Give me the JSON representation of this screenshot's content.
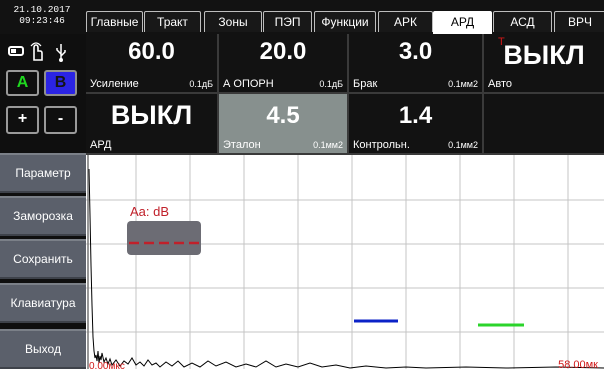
{
  "datetime": {
    "date": "21.10.2017",
    "time": "09:23:46"
  },
  "tabs": [
    "Главные",
    "Тракт",
    "Зоны",
    "ПЭП",
    "Функции",
    "АРК",
    "АРД",
    "АСД",
    "ВРЧ"
  ],
  "active_tab": "АРД",
  "left_buttons": {
    "a": "A",
    "b": "B",
    "plus": "+",
    "minus": "-"
  },
  "side_menu": [
    "Параметр",
    "Заморозка",
    "Сохранить",
    "Клавиатура",
    "Выход"
  ],
  "params": {
    "gain": {
      "value": "60.0",
      "label": "Усиление",
      "unit": "0.1дБ"
    },
    "ref": {
      "value": "20.0",
      "label": "А ОПОРН",
      "unit": "0.1дБ"
    },
    "reject": {
      "value": "3.0",
      "label": "Брак",
      "unit": "0.1мм2"
    },
    "auto": {
      "value": "ВЫКЛ",
      "label": "Авто",
      "overlay": "T"
    },
    "ard": {
      "value": "ВЫКЛ",
      "label": "АРД"
    },
    "etalon": {
      "value": "4.5",
      "label": "Эталон",
      "unit": "0.1мм2"
    },
    "control": {
      "value": "1.4",
      "label": "Контрольн.",
      "unit": "0.1мм2"
    }
  },
  "marker": {
    "label": "Aa: dB",
    "color": "#c0202a"
  },
  "axis": {
    "start": "0.00мкс",
    "end": "58.00мк"
  },
  "colors": {
    "blue_level": "#0b22c7",
    "green_level": "#2bd42b",
    "accent_red": "#d01818"
  }
}
